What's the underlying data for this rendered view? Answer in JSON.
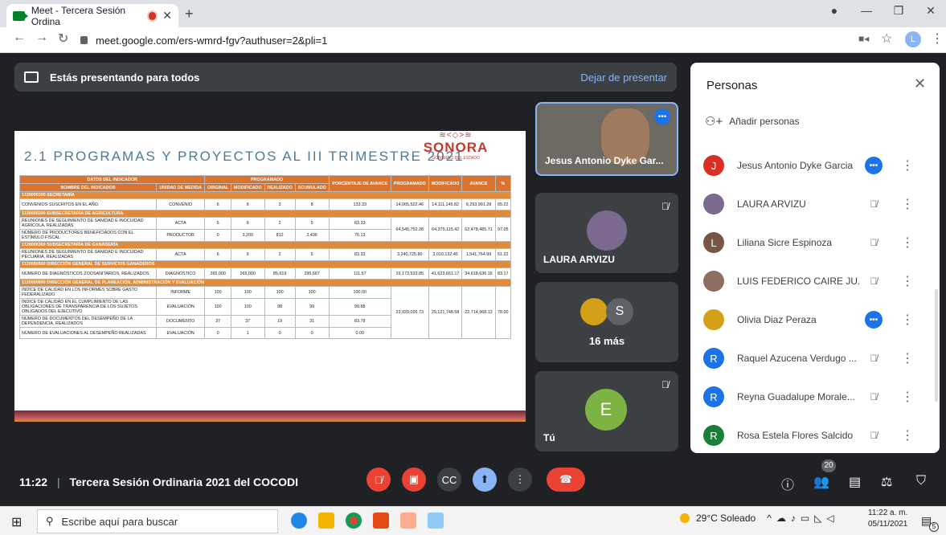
{
  "browser": {
    "tab_title": "Meet - Tercera Sesión Ordina",
    "url": "meet.google.com/ers-wmrd-fgv?authuser=2&pli=1",
    "profile_initial": "L"
  },
  "presenting": {
    "text": "Estás presentando para todos",
    "stop": "Dejar de presentar"
  },
  "slide": {
    "title": "2.1 PROGRAMAS Y PROYECTOS AL III TRIMESTRE 2021",
    "logo": "SONORA",
    "logo_ornament": "≋<◇>≋",
    "logo_tag": "GOBIERNO DEL ESTADO",
    "headers": {
      "datos": "DATOS DEL INDICADOR",
      "programado": "PROGRAMADO",
      "nombre": "NOMBRE DEL INDICADOR",
      "unidad": "UNIDAD DE MEDIDA",
      "original": "ORIGINAL",
      "modificado": "MODIFICADO",
      "realizado": "REALIZADO",
      "acumulado": "ACUMULADO",
      "porcentaje": "PORCENTAJE DE AVANCE",
      "prog2": "PROGRAMADO",
      "mod2": "MODIFICADO",
      "avance": "AVANCE",
      "pct": "%"
    },
    "sections": [
      "1120000100 SECRETARÍA",
      "1120000200 SUBSECRETARÍA DE AGRICULTURA",
      "1120000300 SUBSECRETARÍA DE GANADERÍA",
      "1120000500 DIRECCIÓN GENERAL DE SERVICIOS GANADEROS",
      "1120000600 DIRECCIÓN GENERAL DE PLANEACIÓN, ADMINISTRACIÓN Y EVALUACIÓN"
    ],
    "rows": [
      [
        "CONVENIOS SUSCRITOS EN EL AÑO.",
        "CONVENIO",
        "6",
        "6",
        "3",
        "8",
        "133.33",
        "14,065,522.46",
        "14,111,145.82",
        "9,293,991.28",
        "65.22"
      ],
      [
        "REUNIONES DE SEGUIMIENTO DE SANIDAD E INOCUIDAD AGRÍCOLA, REALIZADAS",
        "ACTA",
        "6",
        "6",
        "2",
        "5",
        "83.33",
        "64,545,752.28",
        "64,375,115.42",
        "62,478,485.71",
        "97.05"
      ],
      [
        "NÚMERO DE PRODUCTORES BENEFICIADOS CON EL ESTÍMULO FISCAL",
        "PRODUCTOR",
        "0",
        "3,200",
        "812",
        "2,436",
        "76.13"
      ],
      [
        "REUNIONES DE SEGUIMIENTO DE SANIDAD E INOCUIDAD PECUARIA, REALIZADAS",
        "ACTA",
        "6",
        "6",
        "2",
        "5",
        "83.33",
        "3,240,725.80",
        "3,010,132.45",
        "1,541,764.99",
        "51.22"
      ],
      [
        "NÚMERO DE DIAGNÓSTICOS ZOOSANITARIOS, REALIZADOS",
        "DIAGNÓSTICO",
        "265,000",
        "265,000",
        "85,619",
        "295,667",
        "111.57",
        "19,173,533.85",
        "41,623,661.17",
        "34,618,636.16",
        "83.17"
      ],
      [
        "ÍNDICE DE CALIDAD EN LOS INFORMES SOBRE GASTO FEDERALIZADO",
        "INFORME",
        "100",
        "100",
        "100",
        "100",
        "100.00",
        "23,929,026.73",
        "29,121,748.58",
        "22,714,968.12",
        "78.00"
      ],
      [
        "ÍNDICE DE CALIDAD EN EL CUMPLIMIENTO DE LAS OBLIGACIONES DE TRANSPARENCIA DE LOS SUJETOS OBLIGADOS DEL EJECUTIVO",
        "EVALUACIÓN",
        "100",
        "100",
        "98",
        "99",
        "99.88"
      ],
      [
        "NÚMERO DE DOCUMENTOS DEL DESEMPEÑO DE LA DEPENDENCIA, REALIZADOS",
        "DOCUMENTO",
        "37",
        "37",
        "19",
        "31",
        "83.78"
      ],
      [
        "NÚMERO DE EVALUACIONES AL DESEMPEÑO REALIZADAS",
        "EVALUACIÓN",
        "0",
        "1",
        "0",
        "0",
        "0.00"
      ]
    ]
  },
  "tiles": {
    "jesus": "Jesus Antonio Dyke Gar...",
    "laura": "LAURA ARVIZU",
    "more": "16 más",
    "more_initial": "S",
    "me": "Tú",
    "me_initial": "E"
  },
  "people": {
    "title": "Personas",
    "add": "Añadir personas",
    "list": [
      {
        "name": "Jesus Antonio Dyke Garcia",
        "initial": "J",
        "color": "#d93025",
        "status": "dots"
      },
      {
        "name": "LAURA ARVIZU",
        "initial": "",
        "color": "#7b6a8d",
        "status": "muted"
      },
      {
        "name": "Liliana Sicre Espinoza",
        "initial": "L",
        "color": "#795548",
        "status": "muted"
      },
      {
        "name": "LUIS FEDERICO CAIRE JU...",
        "initial": "",
        "color": "#8d6e63",
        "status": "muted"
      },
      {
        "name": "Olivia Diaz Peraza",
        "initial": "",
        "color": "#d4a017",
        "status": "dots"
      },
      {
        "name": "Raquel Azucena Verdugo ...",
        "initial": "R",
        "color": "#1a73e8",
        "status": "muted"
      },
      {
        "name": "Reyna Guadalupe Morale...",
        "initial": "R",
        "color": "#1a73e8",
        "status": "muted"
      },
      {
        "name": "Rosa Estela Flores Salcido",
        "initial": "R",
        "color": "#188038",
        "status": "muted"
      }
    ]
  },
  "bottom": {
    "time": "11:22",
    "separator": "|",
    "meeting": "Tercera Sesión Ordinaria 2021 del COCODI",
    "participant_count": "20"
  },
  "taskbar": {
    "search": "Escribe aquí para buscar",
    "weather": "29°C Soleado",
    "time": "11:22 a. m.",
    "date": "05/11/2021",
    "notif_count": "5"
  },
  "icons": {
    "mic": "mic-off-icon",
    "cam": "cam-off-icon",
    "cc": "captions-icon",
    "present": "present-icon",
    "more": "more-icon",
    "end": "end-call-icon"
  }
}
